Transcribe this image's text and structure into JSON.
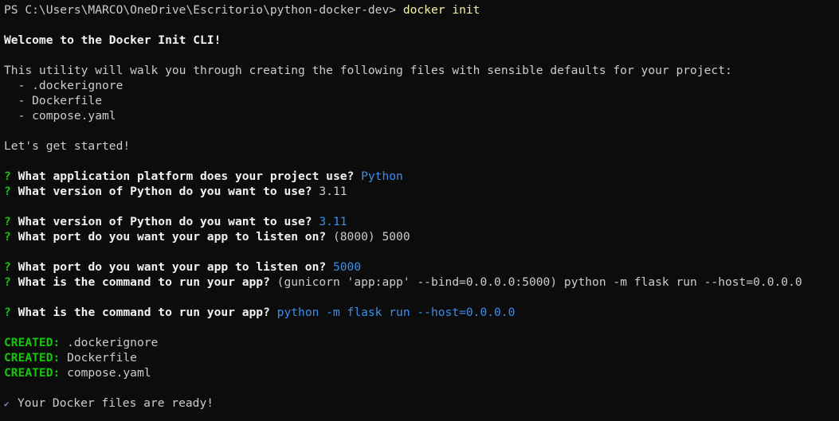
{
  "prompt": {
    "path": "PS C:\\Users\\MARCO\\OneDrive\\Escritorio\\python-docker-dev> ",
    "command": "docker init"
  },
  "welcome": "Welcome to the Docker Init CLI!",
  "intro": "This utility will walk you through creating the following files with sensible defaults for your project:",
  "files_list": [
    "  - .dockerignore",
    "  - Dockerfile",
    "  - compose.yaml"
  ],
  "started": "Let's get started!",
  "q_mark": "? ",
  "q1": {
    "question": "What application platform does your project use? ",
    "answer": "Python"
  },
  "q2_prompt": {
    "question": "What version of Python do you want to use? ",
    "default": "3.11"
  },
  "q2": {
    "question": "What version of Python do you want to use? ",
    "answer": "3.11"
  },
  "q3_prompt": {
    "question": "What port do you want your app to listen on? ",
    "default": "(8000) 5000"
  },
  "q3": {
    "question": "What port do you want your app to listen on? ",
    "answer": "5000"
  },
  "q4_prompt": {
    "question": "What is the command to run your app? ",
    "default": "(gunicorn 'app:app' --bind=0.0.0.0:5000) python -m flask run --host=0.0.0.0"
  },
  "q4": {
    "question": "What is the command to run your app? ",
    "answer": "python -m flask run --host=0.0.0.0"
  },
  "created_label": "CREATED: ",
  "created": [
    ".dockerignore",
    "Dockerfile",
    "compose.yaml"
  ],
  "ready_icon": "✔",
  "ready": "Your Docker files are ready!",
  "colors": {
    "background": "#0c0c0c",
    "text": "#cccccc",
    "command": "#f9f1a5",
    "success": "#16c60c",
    "answer": "#3b8eea"
  }
}
